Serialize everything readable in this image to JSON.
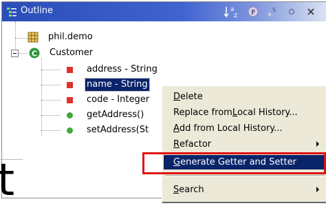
{
  "view": {
    "title": "Outline",
    "toolbar": [
      {
        "name": "sort-icon",
        "label": "a z"
      },
      {
        "name": "hide-fields-icon",
        "label": "F"
      },
      {
        "name": "hide-static-icon",
        "label": "S"
      },
      {
        "name": "hide-nonpublic-icon",
        "label": "o"
      },
      {
        "name": "close-icon",
        "label": "×"
      }
    ]
  },
  "tree": {
    "package": "phil.demo",
    "class": "Customer",
    "members": [
      {
        "label": "address - String",
        "kind": "field",
        "selected": false
      },
      {
        "label": "name - String",
        "kind": "field",
        "selected": true
      },
      {
        "label": "code - Integer",
        "kind": "field",
        "selected": false
      },
      {
        "label": "getAddress()",
        "kind": "method",
        "selected": false
      },
      {
        "label": "setAddress(St",
        "kind": "method",
        "selected": false
      }
    ]
  },
  "menu": {
    "items": [
      {
        "pre": "",
        "key": "D",
        "post": "elete",
        "submenu": false
      },
      {
        "pre": "Replace from ",
        "key": "L",
        "post": "ocal History...",
        "submenu": false
      },
      {
        "pre": "",
        "key": "A",
        "post": "dd from Local History...",
        "submenu": false
      },
      {
        "pre": "",
        "key": "R",
        "post": "efactor",
        "submenu": true
      },
      {
        "pre": "",
        "key": "G",
        "post": "enerate Getter and Setter",
        "submenu": false,
        "highlighted": true
      },
      {
        "pre": "",
        "key": "S",
        "post": "earch",
        "submenu": true
      }
    ]
  },
  "fragment": {
    "text": "t"
  },
  "colors": {
    "title_gradient_start": "#2a4db8",
    "selection": "#0a246a",
    "field_icon": "#e0302b",
    "method_icon": "#41a83a",
    "class_icon": "#2e9a3b",
    "package_icon": "#b58a2a",
    "highlight_box": "#e01010",
    "menu_bg": "#ece9d8"
  }
}
